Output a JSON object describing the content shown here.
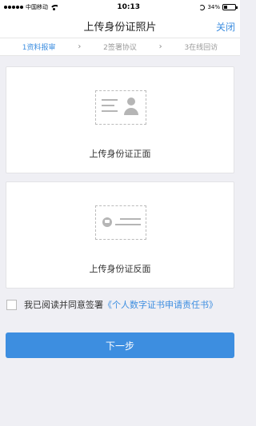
{
  "status_bar": {
    "carrier": "中国移动",
    "time": "10:13",
    "battery_percent": "34%",
    "battery_level": 0.34
  },
  "navbar": {
    "title": "上传身份证照片",
    "close_label": "关闭"
  },
  "steps": [
    {
      "label": "1资料报审",
      "active": true
    },
    {
      "label": "2签署协议",
      "active": false
    },
    {
      "label": "3在线回访",
      "active": false
    }
  ],
  "step_separator": "›",
  "cards": {
    "front_label": "上传身份证正面",
    "back_label": "上传身份证反面"
  },
  "agreement": {
    "prefix": "我已阅读并同意签署",
    "link": "《个人数字证书申请责任书》",
    "checked": false
  },
  "next_button_label": "下一步",
  "colors": {
    "accent": "#3d8ee0",
    "background": "#efeff4"
  }
}
